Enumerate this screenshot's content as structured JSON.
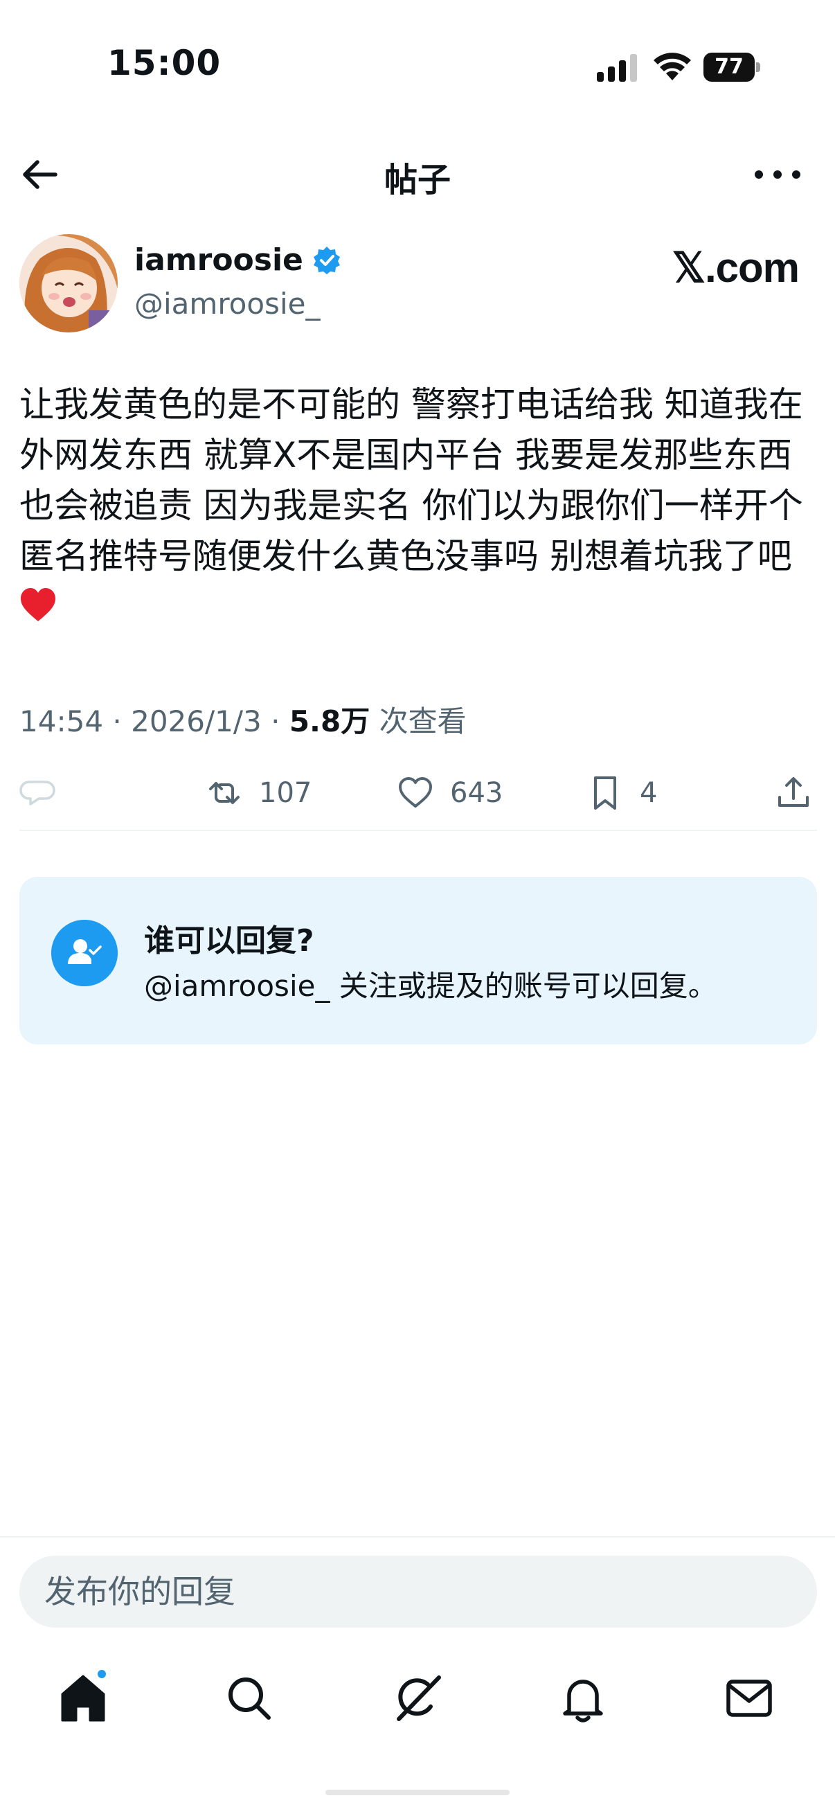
{
  "status_bar": {
    "time": "15:00",
    "battery": "77"
  },
  "header": {
    "title": "帖子"
  },
  "author": {
    "display_name": "iamroosie",
    "handle": "@iamroosie_",
    "site": "𝕏.com"
  },
  "post": {
    "text": "让我发黄色的是不可能的 警察打电话给我 知道我在外网发东西 就算X不是国内平台 我要是发那些东西也会被追责 因为我是实名 你们以为跟你们一样开个匿名推特号随便发什么黄色没事吗 别想着坑我了吧",
    "emoji": "heart-emoji",
    "time": "14:54",
    "separator": " · ",
    "date": "2026/1/3",
    "views": "5.8万",
    "views_label": "次查看"
  },
  "actions": {
    "reposts": "107",
    "likes": "643",
    "bookmarks": "4"
  },
  "reply_settings": {
    "title": "谁可以回复?",
    "description": "@iamroosie_ 关注或提及的账号可以回复。"
  },
  "composer": {
    "placeholder": "发布你的回复"
  },
  "colors": {
    "accent": "#1d9bf0",
    "secondary_text": "#536471",
    "card_bg": "#e8f5fd"
  },
  "tab_bar": [
    "home-icon",
    "search-icon",
    "grok-icon",
    "notifications-icon",
    "messages-icon"
  ]
}
